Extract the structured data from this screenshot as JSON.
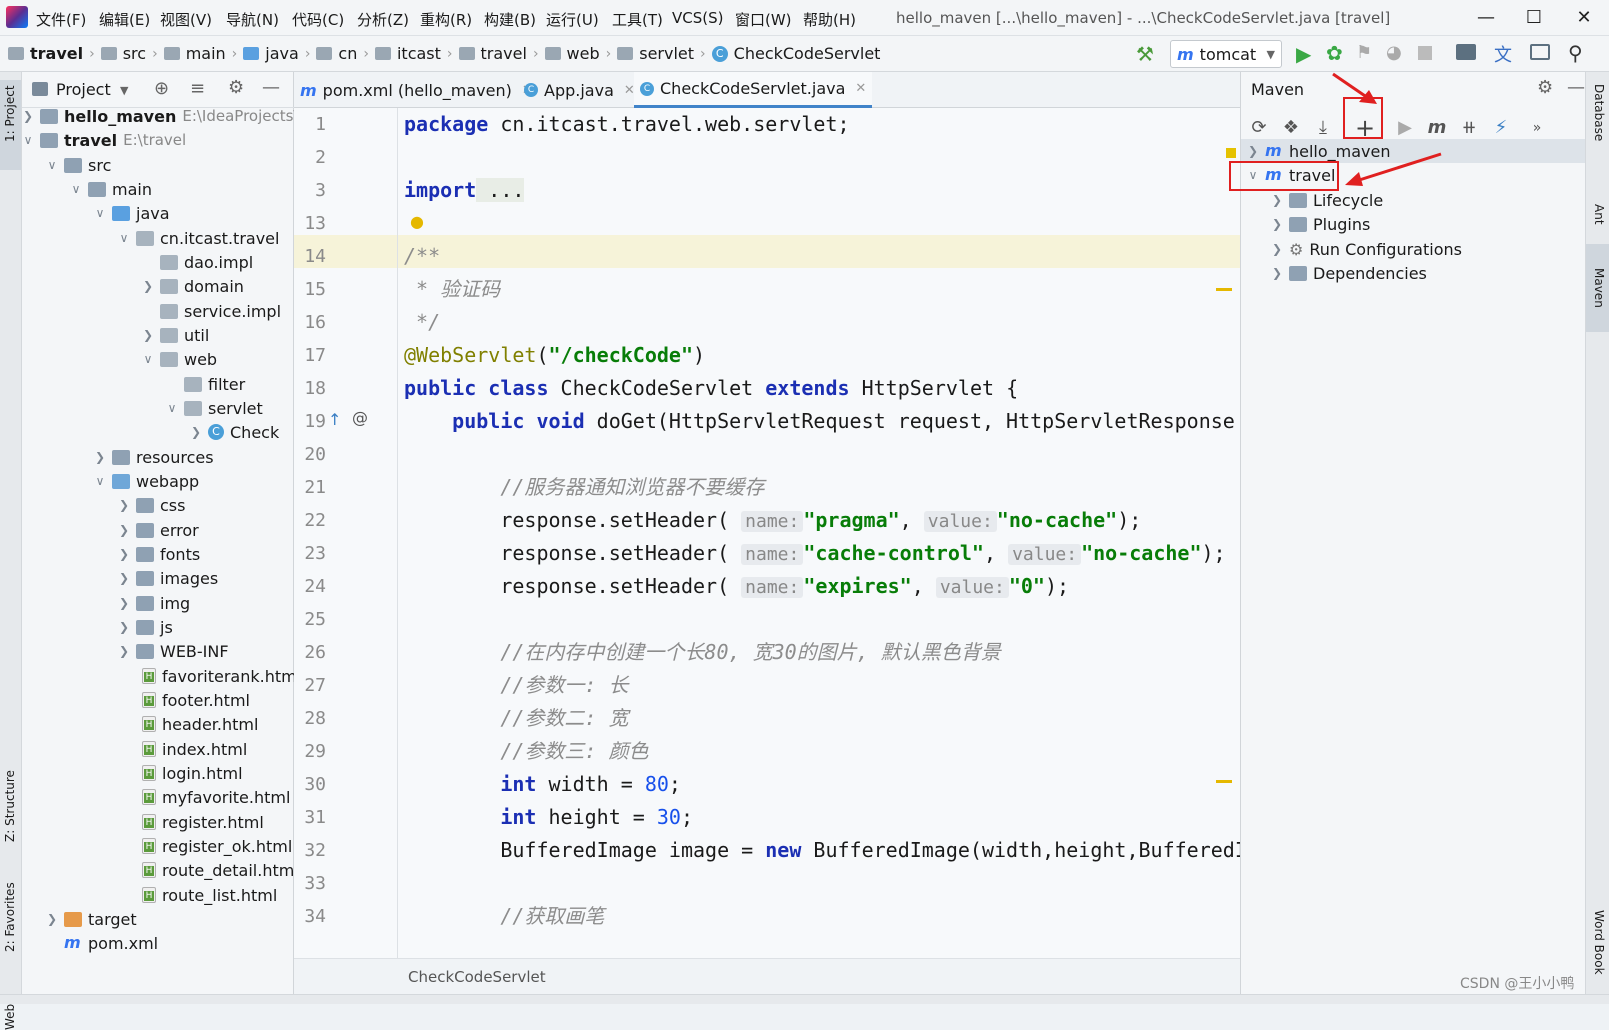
{
  "menu": [
    "文件(F)",
    "编辑(E)",
    "视图(V)",
    "导航(N)",
    "代码(C)",
    "分析(Z)",
    "重构(R)",
    "构建(B)",
    "运行(U)",
    "工具(T)",
    "VCS(S)",
    "窗口(W)",
    "帮助(H)"
  ],
  "window_title": "hello_maven [...\\hello_maven] - ...\\CheckCodeServlet.java [travel]",
  "breadcrumb": [
    "travel",
    "src",
    "main",
    "java",
    "cn",
    "itcast",
    "travel",
    "web",
    "servlet",
    "CheckCodeServlet"
  ],
  "run_config": "tomcat",
  "left_strip": {
    "project": "1: Project",
    "structure": "Z: Structure",
    "favorites": "2: Favorites",
    "web": "Web"
  },
  "right_strip": {
    "database": "Database",
    "ant": "Ant",
    "maven": "Maven",
    "wordbook": "Word Book"
  },
  "project_panel": {
    "title": "Project",
    "rows": [
      {
        "label": "hello_maven",
        "path": "E:\\IdeaProjects\\"
      },
      {
        "label": "travel",
        "path": "E:\\travel"
      },
      {
        "label": "src"
      },
      {
        "label": "main"
      },
      {
        "label": "java"
      },
      {
        "label": "cn.itcast.travel"
      },
      {
        "label": "dao.impl"
      },
      {
        "label": "domain"
      },
      {
        "label": "service.impl"
      },
      {
        "label": "util"
      },
      {
        "label": "web"
      },
      {
        "label": "filter"
      },
      {
        "label": "servlet"
      },
      {
        "label": "Check"
      },
      {
        "label": "resources"
      },
      {
        "label": "webapp"
      },
      {
        "label": "css"
      },
      {
        "label": "error"
      },
      {
        "label": "fonts"
      },
      {
        "label": "images"
      },
      {
        "label": "img"
      },
      {
        "label": "js"
      },
      {
        "label": "WEB-INF"
      },
      {
        "label": "favoriterank.htm"
      },
      {
        "label": "footer.html"
      },
      {
        "label": "header.html"
      },
      {
        "label": "index.html"
      },
      {
        "label": "login.html"
      },
      {
        "label": "myfavorite.html"
      },
      {
        "label": "register.html"
      },
      {
        "label": "register_ok.html"
      },
      {
        "label": "route_detail.htm"
      },
      {
        "label": "route_list.html"
      },
      {
        "label": "target"
      },
      {
        "label": "pom.xml"
      }
    ]
  },
  "editor": {
    "tabs": [
      {
        "label": "pom.xml (hello_maven)"
      },
      {
        "label": "App.java"
      },
      {
        "label": "CheckCodeServlet.java"
      }
    ],
    "line_numbers": [
      "1",
      "2",
      "3",
      "13",
      "14",
      "15",
      "16",
      "17",
      "18",
      "19",
      "20",
      "21",
      "22",
      "23",
      "24",
      "25",
      "26",
      "27",
      "28",
      "29",
      "30",
      "31",
      "32",
      "33",
      "34"
    ],
    "code": {
      "l1_kw": "package",
      "l1": " cn.itcast.travel.web.servlet;",
      "l3_kw": "import",
      "l3": " ...",
      "l14": "/**",
      "l15": " * 验证码",
      "l16": " */",
      "l17_ann": "@WebServlet",
      "l17_a": "(",
      "l17_str": "\"/checkCode\"",
      "l17_b": ")",
      "l18_kw": "public class",
      "l18_a": " CheckCodeServlet ",
      "l18_kw2": "extends",
      "l18_b": " HttpServlet {",
      "l19_kw": "public void",
      "l19": " doGet(HttpServletRequest request, HttpServletResponse re",
      "l21": "//服务器通知浏览器不要缓存",
      "l22_a": "response.setHeader(",
      "l22_h1": "name:",
      "l22_s1": "\"pragma\"",
      "l22_c": ",",
      "l22_h2": "value:",
      "l22_s2": "\"no-cache\"",
      "l22_e": ");",
      "l23_a": "response.setHeader(",
      "l23_h1": "name:",
      "l23_s1": "\"cache-control\"",
      "l23_c": ",",
      "l23_h2": "value:",
      "l23_s2": "\"no-cache\"",
      "l23_e": ");",
      "l24_a": "response.setHeader(",
      "l24_h1": "name:",
      "l24_s1": "\"expires\"",
      "l24_c": ",",
      "l24_h2": "value:",
      "l24_s2": "\"0\"",
      "l24_e": ");",
      "l26": "//在内存中创建一个长80, 宽30的图片, 默认黑色背景",
      "l27": "//参数一: 长",
      "l28": "//参数二: 宽",
      "l29": "//参数三: 颜色",
      "l30_kw": "int",
      "l30_a": " width = ",
      "l30_n": "80",
      "l30_b": ";",
      "l31_kw": "int",
      "l31_a": " height = ",
      "l31_n": "30",
      "l31_b": ";",
      "l32_a": "BufferedImage image = ",
      "l32_kw": "new",
      "l32_b": " BufferedImage(width,height,BufferedIma",
      "l34": "//获取画笔"
    },
    "footer_label": "CheckCodeServlet"
  },
  "maven_panel": {
    "title": "Maven",
    "items": [
      {
        "label": "hello_maven"
      },
      {
        "label": "travel"
      },
      {
        "label": "Lifecycle"
      },
      {
        "label": "Plugins"
      },
      {
        "label": "Run Configurations"
      },
      {
        "label": "Dependencies"
      }
    ]
  },
  "watermark": "CSDN @王小小鸭",
  "colors": {
    "accent": "#4083c9",
    "annotation_red": "#e02020",
    "keyword": "#1b2fb3",
    "string": "#087d08"
  }
}
